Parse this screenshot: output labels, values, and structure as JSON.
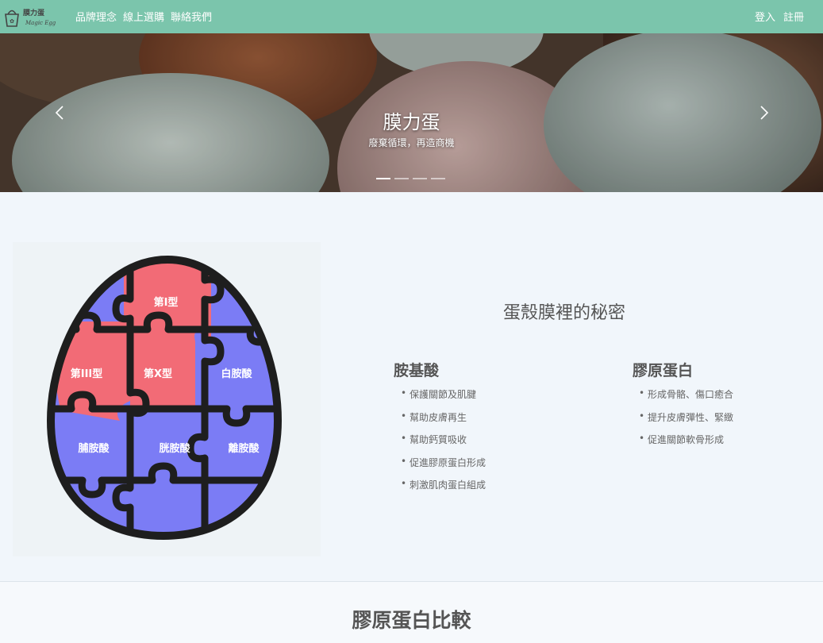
{
  "nav": {
    "logo_text": "膜力蛋",
    "logo_sub": "Magic Egg",
    "links": [
      "品牌理念",
      "線上選購",
      "聯絡我們"
    ],
    "login": "登入",
    "register": "註冊",
    "brand_color": "#7bc5ac"
  },
  "hero": {
    "title": "膜力蛋",
    "subtitle": "廢棄循環，再造商機",
    "slide_count": 4,
    "active_slide": 1
  },
  "puzzle": {
    "pieces": [
      "第I型",
      "第III型",
      "第X型",
      "白胺酸",
      "脯胺酸",
      "胱胺酸",
      "離胺酸"
    ],
    "collagen_color": "#f26b76",
    "amino_color": "#7b7cf5"
  },
  "secret": {
    "title": "蛋殼膜裡的秘密",
    "amino": {
      "heading": "胺基酸",
      "items": [
        "保護關節及肌腱",
        "幫助皮膚再生",
        "幫助鈣質吸收",
        "促進膠原蛋白形成",
        "刺激肌肉蛋白組成"
      ]
    },
    "collagen": {
      "heading": "膠原蛋白",
      "items": [
        "形成骨骼、傷口癒合",
        "提升皮膚彈性、緊緻",
        "促進關節軟骨形成"
      ]
    }
  },
  "compare": {
    "title": "膠原蛋白比較"
  }
}
